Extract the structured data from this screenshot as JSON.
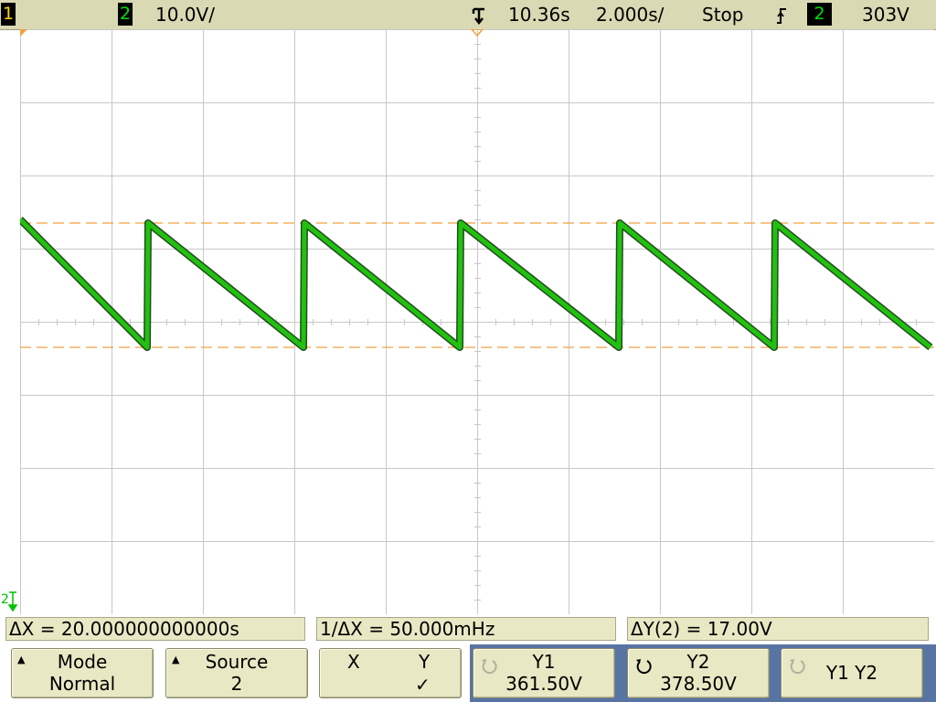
{
  "status_bar": {
    "channel1_number": "1",
    "channel2_number": "2",
    "channel2_scale": "10.0V/",
    "time_reference": "10.36s",
    "time_scale": "2.000s/",
    "run_state": "Stop",
    "trigger_channel": "2",
    "trigger_level": "303V",
    "colors": {
      "channel1": "#ffd400",
      "channel2": "#00e000",
      "bar_bg": "#d9d9b3"
    },
    "icons": {
      "trigger_position": "trigger-position-icon",
      "trigger_slope": "rising-edge-trigger-icon"
    }
  },
  "screen": {
    "ground_marker_label": "2",
    "grid": {
      "divisions_x": 10,
      "divisions_y": 8,
      "grid_color": "#c8c8c8"
    },
    "cursor_color": "#f0a040",
    "trace_color": "#22c010"
  },
  "chart_data": {
    "type": "line",
    "xlim": [
      0,
      20
    ],
    "ylim": [
      325,
      405
    ],
    "series": [
      {
        "name": "",
        "x": [
          0.0,
          2.78,
          2.8,
          6.2,
          6.22,
          9.62,
          9.64,
          13.1,
          13.12,
          16.5,
          16.52,
          19.92
        ],
        "y": [
          379.0,
          361.5,
          378.5,
          361.5,
          378.5,
          361.5,
          378.5,
          361.5,
          378.5,
          361.5,
          378.5,
          361.5
        ]
      }
    ],
    "cursors": {
      "y1": 361.5,
      "y2": 378.5
    }
  },
  "readouts": {
    "delta_x": "ΔX = 20.000000000000s",
    "inverse_delta_x": "1/ΔX = 50.000mHz",
    "delta_y": "ΔY(2) = 17.00V"
  },
  "softkeys": {
    "mode": {
      "label": "Mode",
      "value": "Normal"
    },
    "source": {
      "label": "Source",
      "value": "2"
    },
    "xy": {
      "x_label": "X",
      "y_label": "Y",
      "selected": "✓"
    },
    "y1": {
      "label": "Y1",
      "value": "361.50V"
    },
    "y2": {
      "label": "Y2",
      "value": "378.50V"
    },
    "y1y2": {
      "label": "Y1 Y2"
    }
  }
}
